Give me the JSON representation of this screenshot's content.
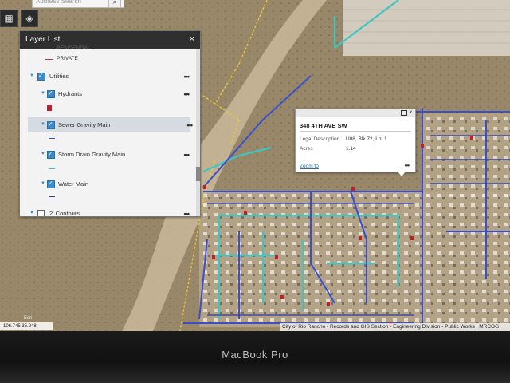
{
  "app": {
    "search_placeholder": "Address Search"
  },
  "layer_list": {
    "title": "Layer List",
    "partial_top_label": "RESIDENTIAL",
    "items": [
      {
        "label": "PRIVATE"
      },
      {
        "label": "Utilities"
      },
      {
        "label": "Hydrants"
      },
      {
        "label": "Sewer Gravity Main"
      },
      {
        "label": "Storm Drain Gravity Main"
      },
      {
        "label": "Water Main"
      },
      {
        "label": "2' Contours"
      }
    ],
    "more_glyph": "•••",
    "close_glyph": "×"
  },
  "popup": {
    "title": "348 4TH AVE SW",
    "fields": [
      {
        "label": "Legal Description",
        "value": "U08, Blk 72, Lot 1"
      },
      {
        "label": "Acres",
        "value": "1.14"
      }
    ],
    "zoom_label": "Zoom to",
    "more_glyph": "•••",
    "close_glyph": "×"
  },
  "map": {
    "coordinates": "-106.745 35.248 Degrees",
    "esri_label": "Esri",
    "attribution": "City of Rio Rancho - Records and GIS Section - Engineering Division - Public Works | MRCOG"
  },
  "device": {
    "brand": "MacBook Pro"
  },
  "colors": {
    "sewer": "#3a4fd0",
    "storm": "#3fc6c0",
    "water": "#2a3aa8",
    "hydrant": "#c0202a",
    "parcel": "#e8c93a",
    "accent": "#3a8ccc"
  },
  "icons": {
    "apps": "grid-icon",
    "layers": "layers-icon",
    "search": "search-icon"
  }
}
